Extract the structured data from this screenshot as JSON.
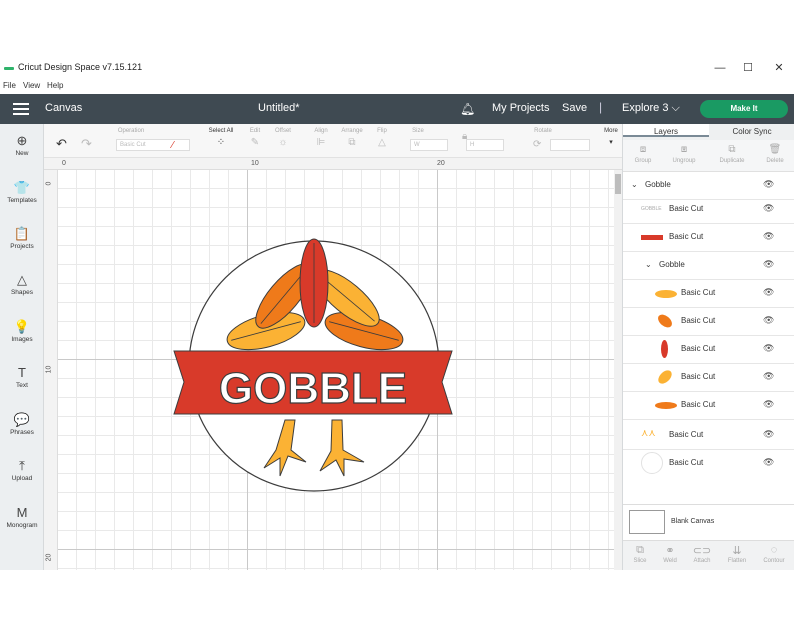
{
  "window": {
    "title": "Cricut Design Space  v7.15.121",
    "controls": [
      "—",
      "☐",
      "✕"
    ]
  },
  "menu": [
    "File",
    "View",
    "Help"
  ],
  "header": {
    "canvas_label": "Canvas",
    "doc_title": "Untitled*",
    "my_projects": "My Projects",
    "save": "Save",
    "separator": "|",
    "machine": "Explore 3 ⌵",
    "make_it": "Make It"
  },
  "sidebar": [
    {
      "label": "New",
      "icon": "⊕"
    },
    {
      "label": "Templates",
      "icon": "👕"
    },
    {
      "label": "Projects",
      "icon": "📋"
    },
    {
      "label": "Shapes",
      "icon": "△"
    },
    {
      "label": "Images",
      "icon": "💡"
    },
    {
      "label": "Text",
      "icon": "T"
    },
    {
      "label": "Phrases",
      "icon": "💬"
    },
    {
      "label": "Upload",
      "icon": "⤒"
    },
    {
      "label": "Monogram",
      "icon": "M"
    }
  ],
  "toolbar": {
    "operation": "Operation",
    "operation_value": "Basic Cut",
    "select_all": "Select All",
    "edit": "Edit",
    "offset": "Offset",
    "align": "Align",
    "arrange": "Arrange",
    "flip": "Flip",
    "size": "Size",
    "w": "W",
    "h": "H",
    "rotate": "Rotate",
    "more": "More"
  },
  "ruler": {
    "top": [
      "0",
      "10",
      "20"
    ],
    "left": [
      "0",
      "10",
      "20"
    ]
  },
  "design": {
    "banner_text": "GOBBLE",
    "colors": {
      "red": "#d83a2a",
      "orange": "#ef7a1a",
      "yellow": "#fbb234",
      "outline": "#3c3c3c"
    }
  },
  "panel": {
    "tabs": [
      "Layers",
      "Color Sync"
    ],
    "tools": [
      "Group",
      "Ungroup",
      "Duplicate",
      "Delete"
    ],
    "layers": [
      {
        "name": "Gobble",
        "kind": "group",
        "indent": 0,
        "expanded": true
      },
      {
        "name": "Basic Cut",
        "kind": "layer",
        "indent": 1,
        "thumb": "text"
      },
      {
        "name": "Basic Cut",
        "kind": "layer",
        "indent": 1,
        "thumb": "banner"
      },
      {
        "name": "Gobble",
        "kind": "group",
        "indent": 1,
        "expanded": true
      },
      {
        "name": "Basic Cut",
        "kind": "layer",
        "indent": 2,
        "thumb": "feather-yellow"
      },
      {
        "name": "Basic Cut",
        "kind": "layer",
        "indent": 2,
        "thumb": "feather-orange"
      },
      {
        "name": "Basic Cut",
        "kind": "layer",
        "indent": 2,
        "thumb": "feather-red"
      },
      {
        "name": "Basic Cut",
        "kind": "layer",
        "indent": 2,
        "thumb": "feather-yellow2"
      },
      {
        "name": "Basic Cut",
        "kind": "layer",
        "indent": 2,
        "thumb": "feather-orange2"
      },
      {
        "name": "Basic Cut",
        "kind": "layer",
        "indent": 1,
        "thumb": "feet"
      },
      {
        "name": "Basic Cut",
        "kind": "layer",
        "indent": 1,
        "thumb": "circle"
      }
    ],
    "blank_canvas": "Blank Canvas",
    "bottom_tools": [
      "Slice",
      "Weld",
      "Attach",
      "Flatten",
      "Contour"
    ]
  }
}
